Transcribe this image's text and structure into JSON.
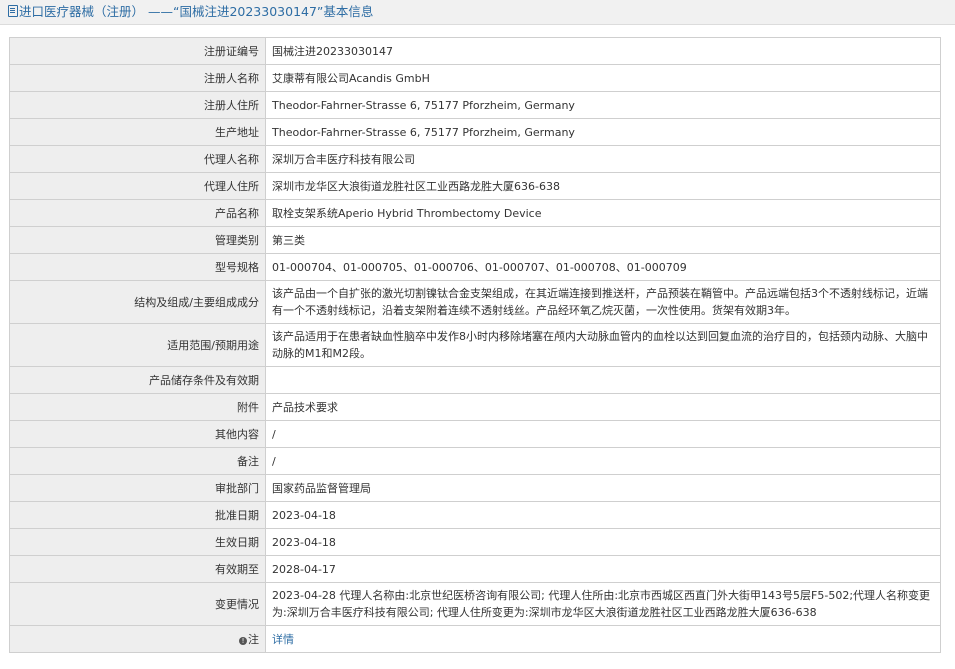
{
  "header": {
    "title": "进口医疗器械（注册） ——“国械注进20233030147”基本信息"
  },
  "rows": [
    {
      "label": "注册证编号",
      "value": "国械注进20233030147"
    },
    {
      "label": "注册人名称",
      "value": "艾康蒂有限公司Acandis GmbH"
    },
    {
      "label": "注册人住所",
      "value": "Theodor-Fahrner-Strasse 6, 75177 Pforzheim, Germany"
    },
    {
      "label": "生产地址",
      "value": "Theodor-Fahrner-Strasse 6, 75177 Pforzheim, Germany"
    },
    {
      "label": "代理人名称",
      "value": "深圳万合丰医疗科技有限公司"
    },
    {
      "label": "代理人住所",
      "value": "深圳市龙华区大浪街道龙胜社区工业西路龙胜大厦636-638"
    },
    {
      "label": "产品名称",
      "value": "取栓支架系统Aperio Hybrid Thrombectomy Device"
    },
    {
      "label": "管理类别",
      "value": "第三类"
    },
    {
      "label": "型号规格",
      "value": "01-000704、01-000705、01-000706、01-000707、01-000708、01-000709"
    },
    {
      "label": "结构及组成/主要组成成分",
      "value": "该产品由一个自扩张的激光切割镍钛合金支架组成，在其近端连接到推送杆，产品预装在鞘管中。产品远端包括3个不透射线标记，近端有一个不透射线标记，沿着支架附着连续不透射线丝。产品经环氧乙烷灭菌，一次性使用。货架有效期3年。"
    },
    {
      "label": "适用范围/预期用途",
      "value": "该产品适用于在患者缺血性脑卒中发作8小时内移除堵塞在颅内大动脉血管内的血栓以达到回复血流的治疗目的，包括颈内动脉、大脑中动脉的M1和M2段。"
    },
    {
      "label": "产品储存条件及有效期",
      "value": ""
    },
    {
      "label": "附件",
      "value": "产品技术要求"
    },
    {
      "label": "其他内容",
      "value": "/"
    },
    {
      "label": "备注",
      "value": "/"
    },
    {
      "label": "审批部门",
      "value": "国家药品监督管理局"
    },
    {
      "label": "批准日期",
      "value": "2023-04-18"
    },
    {
      "label": "生效日期",
      "value": "2023-04-18"
    },
    {
      "label": "有效期至",
      "value": "2028-04-17"
    },
    {
      "label": "变更情况",
      "value": "2023-04-28 代理人名称由:北京世纪医桥咨询有限公司; 代理人住所由:北京市西城区西直门外大街甲143号5层F5-502;代理人名称变更为:深圳万合丰医疗科技有限公司; 代理人住所变更为:深圳市龙华区大浪街道龙胜社区工业西路龙胜大厦636-638"
    }
  ],
  "note": {
    "label": "注",
    "icon": "warning-icon",
    "link_text": "详情"
  }
}
